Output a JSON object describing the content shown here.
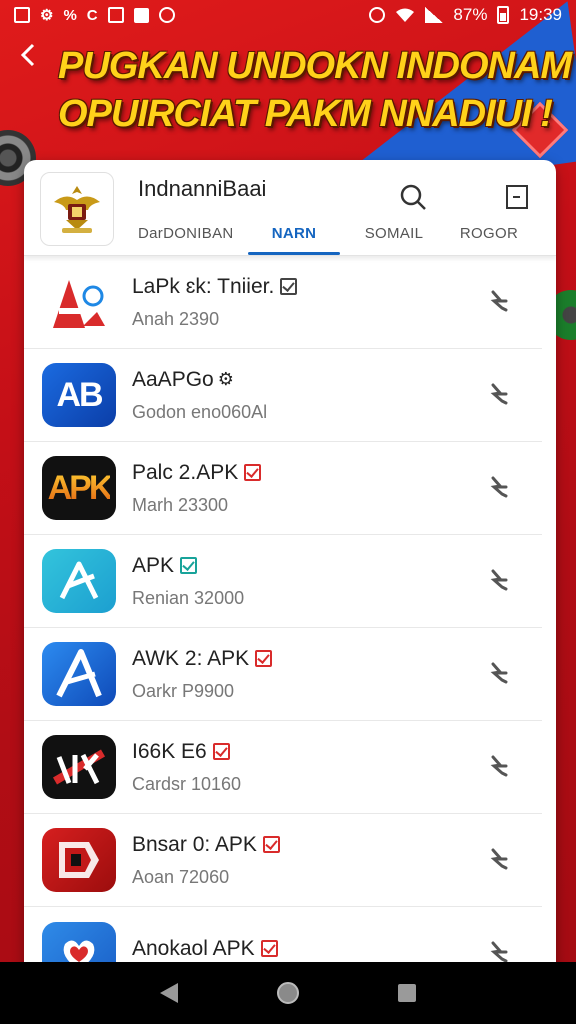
{
  "status_bar": {
    "left_icons": [
      "image-icon",
      "settings-icon",
      "wifi-call-icon",
      "c-icon",
      "notification-icon",
      "square-icon",
      "clock-icon"
    ],
    "battery": "87%",
    "time": "19:39"
  },
  "banner": {
    "line1": "PUGKAN UNDOKN INDONAM",
    "line2": "OPUIRCIAT PAKM NNADIUI !"
  },
  "header": {
    "title": "IndnanniBaai",
    "tabs": [
      {
        "label": "DarDONIBAN",
        "active": false
      },
      {
        "label": "NARN",
        "active": true
      },
      {
        "label": "SOMAIL",
        "active": false
      },
      {
        "label": "ROGOR",
        "active": false
      }
    ]
  },
  "apps": [
    {
      "title": "LaPk ɛk: Tniier.",
      "subtitle": "Anah 2390",
      "badge": "gray"
    },
    {
      "title": "AaAPGo",
      "subtitle": "Godon eno060Al",
      "badge": "gear",
      "icon_text": "AB"
    },
    {
      "title": "Palc 2.APK",
      "subtitle": "Marh 23300",
      "badge": "red",
      "icon_text": "APK"
    },
    {
      "title": "APK",
      "subtitle": "Renian 32000",
      "badge": "teal"
    },
    {
      "title": "AWK 2: APK",
      "subtitle": "Oarkr P9900",
      "badge": "red"
    },
    {
      "title": "I66K E6",
      "subtitle": "Cardsr 10160",
      "badge": "red"
    },
    {
      "title": "Bnsar 0: APK",
      "subtitle": "Aoan 72060",
      "badge": "red"
    },
    {
      "title": "Anokaol APK",
      "subtitle": "",
      "badge": "red"
    }
  ],
  "colors": {
    "accent": "#1565c0",
    "banner_text": "#ffd21a",
    "background": "#c8101a"
  }
}
